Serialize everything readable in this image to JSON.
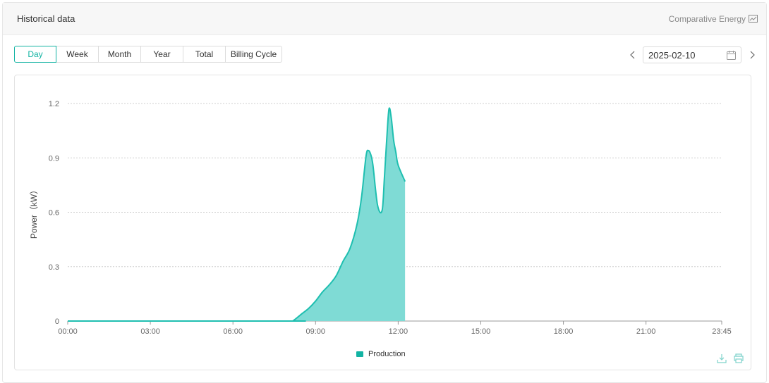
{
  "panel": {
    "title": "Historical data",
    "compare_label": "Comparative Energy",
    "compare_icon": "chart-icon"
  },
  "tabs": [
    "Day",
    "Week",
    "Month",
    "Year",
    "Total",
    "Billing Cycle"
  ],
  "active_tab": "Day",
  "date": {
    "value": "2025-02-10",
    "prev_icon": "chevron-left-icon",
    "next_icon": "chevron-right-icon",
    "calendar_icon": "calendar-icon"
  },
  "colors": {
    "accent": "#12b3a3",
    "area_fill": "#7fdbd5",
    "line": "#1fbfb0",
    "grid": "#cfcfcf",
    "axis": "#999999"
  },
  "chart_data": {
    "type": "area",
    "ylabel": "Power（kW）",
    "xlabel": "",
    "x_tick_labels": [
      "00:00",
      "03:00",
      "06:00",
      "09:00",
      "12:00",
      "15:00",
      "18:00",
      "21:00",
      "23:45"
    ],
    "y_tick_labels": [
      "0",
      "0.3",
      "0.6",
      "0.9",
      "1.2"
    ],
    "ylim": [
      0,
      1.2
    ],
    "xlim": [
      "00:00",
      "23:45"
    ],
    "grid": true,
    "legend_position": "bottom-center",
    "series": [
      {
        "name": "Production",
        "x": [
          "00:00",
          "08:00",
          "08:10",
          "08:30",
          "08:45",
          "09:00",
          "09:15",
          "09:30",
          "09:45",
          "10:00",
          "10:15",
          "10:30",
          "10:40",
          "10:50",
          "10:55",
          "11:00",
          "11:05",
          "11:15",
          "11:25",
          "11:30",
          "11:35",
          "11:40",
          "11:45",
          "11:50",
          "11:55",
          "12:00",
          "12:15"
        ],
        "values": [
          0,
          0,
          0.0,
          0.04,
          0.07,
          0.11,
          0.16,
          0.2,
          0.25,
          0.33,
          0.4,
          0.53,
          0.68,
          0.91,
          0.94,
          0.92,
          0.86,
          0.64,
          0.61,
          0.79,
          1.0,
          1.17,
          1.12,
          1.0,
          0.93,
          0.86,
          0.77
        ]
      }
    ]
  },
  "tools": {
    "download_icon": "download-icon",
    "print_icon": "print-icon"
  }
}
